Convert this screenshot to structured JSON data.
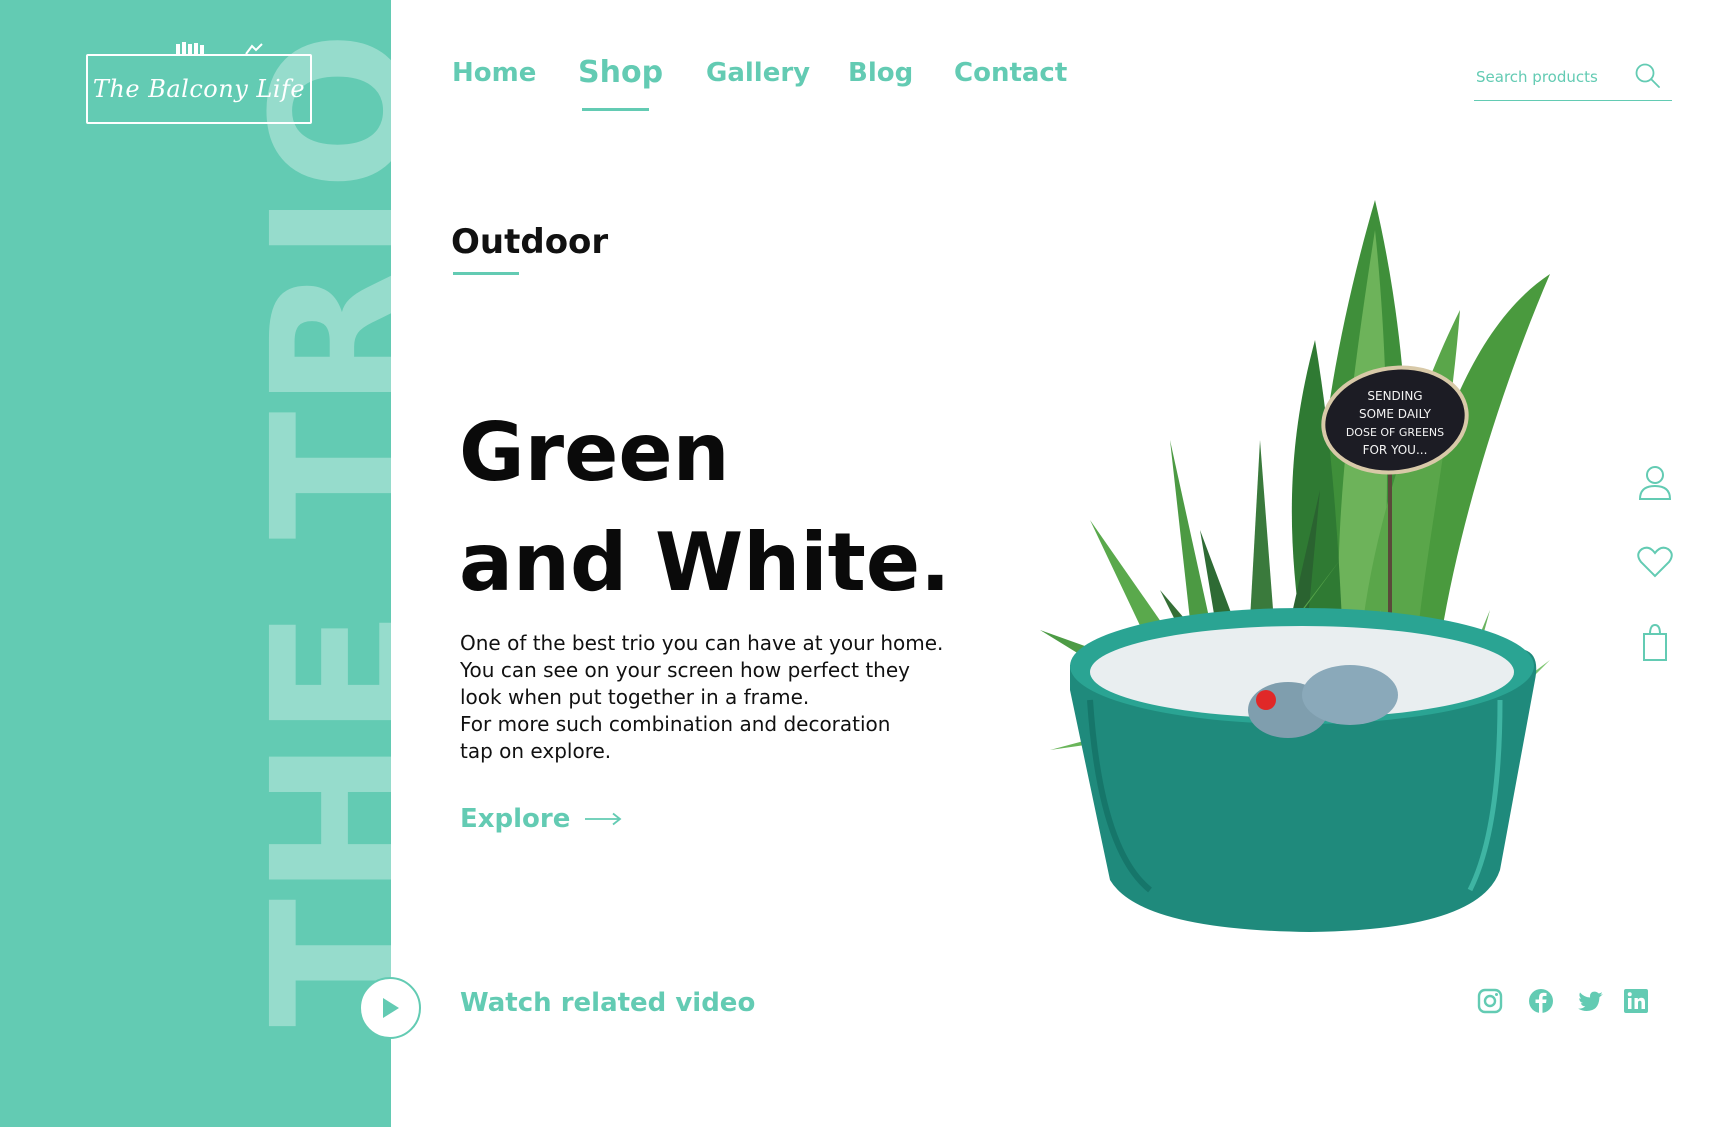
{
  "brand": {
    "logo_text": "The Balcony Life"
  },
  "sidebar": {
    "vertical_text": "THE TRIO"
  },
  "nav": {
    "items": [
      {
        "label": "Home",
        "active": false
      },
      {
        "label": "Shop",
        "active": true
      },
      {
        "label": "Gallery",
        "active": false
      },
      {
        "label": "Blog",
        "active": false
      },
      {
        "label": "Contact",
        "active": false
      }
    ]
  },
  "search": {
    "placeholder": "Search products"
  },
  "hero": {
    "category": "Outdoor",
    "headline_line1": "Green",
    "headline_line2": "and White.",
    "description_lines": [
      "One of the best trio you can have at your home.",
      "You can see on your screen how perfect they",
      "look when put together in a frame.",
      "For more such combination and decoration",
      "tap on explore."
    ],
    "explore_label": "Explore"
  },
  "product": {
    "tag_lines": [
      "SENDING",
      "SOME DAILY",
      "DOSE OF GREENS",
      "FOR YOU..."
    ]
  },
  "video": {
    "label": "Watch related video"
  },
  "side_icons": [
    "user-icon",
    "heart-icon",
    "shopping-bag-icon"
  ],
  "socials": [
    "instagram-icon",
    "facebook-icon",
    "twitter-icon",
    "linkedin-icon"
  ],
  "colors": {
    "accent": "#63cbb3",
    "text": "#111111",
    "background": "#ffffff",
    "pot": "#1f8a7c"
  }
}
